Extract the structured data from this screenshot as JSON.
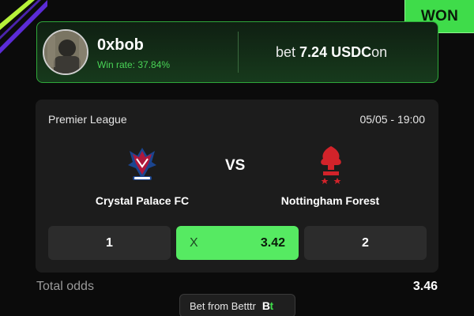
{
  "status_badge": "WON",
  "user": {
    "name": "0xbob",
    "win_rate": "Win rate: 37.84%"
  },
  "bet": {
    "prefix": "bet",
    "amount": "7.24",
    "currency": "USDC",
    "suffix": "on"
  },
  "match": {
    "league": "Premier League",
    "datetime": "05/05 - 19:00",
    "vs": "VS",
    "home_team": "Crystal Palace FC",
    "away_team": "Nottingham Forest",
    "home_logo_icon": "crystal-palace-crest-icon",
    "away_logo_icon": "nottingham-forest-crest-icon"
  },
  "odds": [
    {
      "label": "1",
      "value": ""
    },
    {
      "label": "X",
      "value": "3.42",
      "selected": true
    },
    {
      "label": "2",
      "value": ""
    }
  ],
  "total": {
    "label": "Total odds",
    "value": "3.46"
  },
  "footer": {
    "text": "Bet from Betttr",
    "brand_logo": "Bt"
  },
  "colors": {
    "accent_green": "#3fdc4a",
    "selected_odd": "#56ea62",
    "background": "#0b0b0b",
    "card": "#1c1c1c",
    "stripe_purple": "#5b2bd6",
    "stripe_lime": "#b6f23a",
    "home_red": "#c8102e",
    "away_red": "#d2232a",
    "home_blue": "#1b458f"
  }
}
